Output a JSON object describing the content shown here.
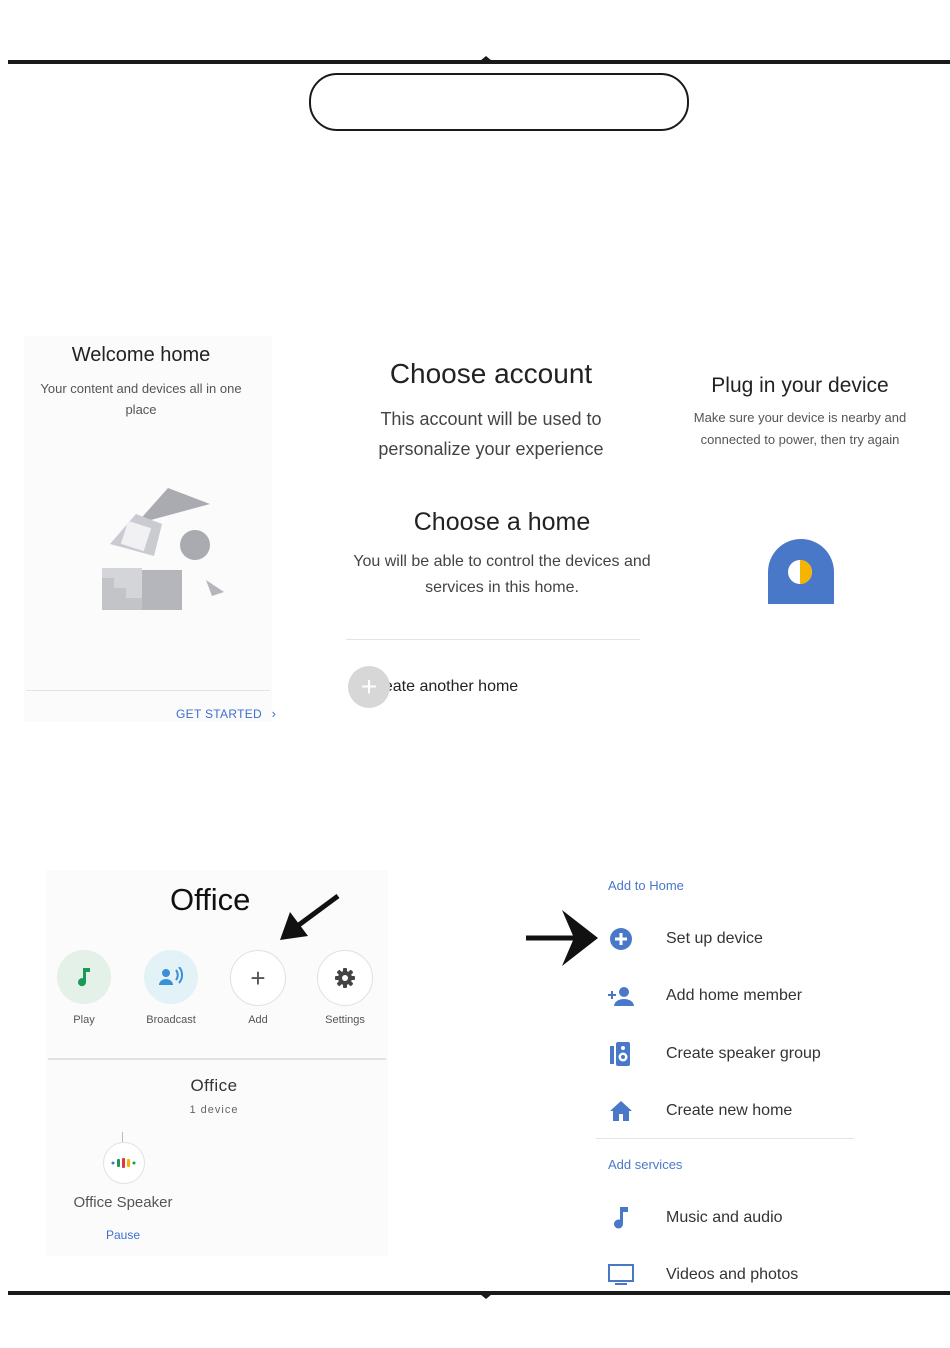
{
  "colors": {
    "blue": "#4a78c9",
    "green": "#1a9a56",
    "grey_circle": "#d7d7d7"
  },
  "welcome": {
    "title": "Welcome home",
    "subtitle": "Your content and devices all in one place",
    "cta": "GET STARTED",
    "cta_chevron": "›"
  },
  "choose_account": {
    "title": "Choose account",
    "subtitle": "This account will be used to personalize your experience"
  },
  "choose_home": {
    "title": "Choose a home",
    "subtitle": "You will be able to control the devices and services in this home.",
    "create_another": "Create another home"
  },
  "plug_in": {
    "title": "Plug in your device",
    "subtitle": "Make sure your device is nearby and connected to power, then try again"
  },
  "office": {
    "title": "Office",
    "actions": [
      {
        "label": "Play",
        "icon": "music-note-icon"
      },
      {
        "label": "Broadcast",
        "icon": "broadcast-icon"
      },
      {
        "label": "Add",
        "icon": "plus-icon"
      },
      {
        "label": "Settings",
        "icon": "gear-icon"
      }
    ],
    "room_title": "Office",
    "room_count": "1 device",
    "device_name": "Office Speaker",
    "device_action": "Pause"
  },
  "add_menu": {
    "header_home": "Add to Home",
    "items_home": [
      {
        "label": "Set up device",
        "icon": "plus-circle-icon"
      },
      {
        "label": "Add home member",
        "icon": "add-person-icon"
      },
      {
        "label": "Create speaker group",
        "icon": "speaker-group-icon"
      },
      {
        "label": "Create new home",
        "icon": "home-icon"
      }
    ],
    "header_services": "Add services",
    "items_services": [
      {
        "label": "Music and audio",
        "icon": "music-note-icon"
      },
      {
        "label": "Videos and photos",
        "icon": "tv-icon"
      }
    ]
  }
}
